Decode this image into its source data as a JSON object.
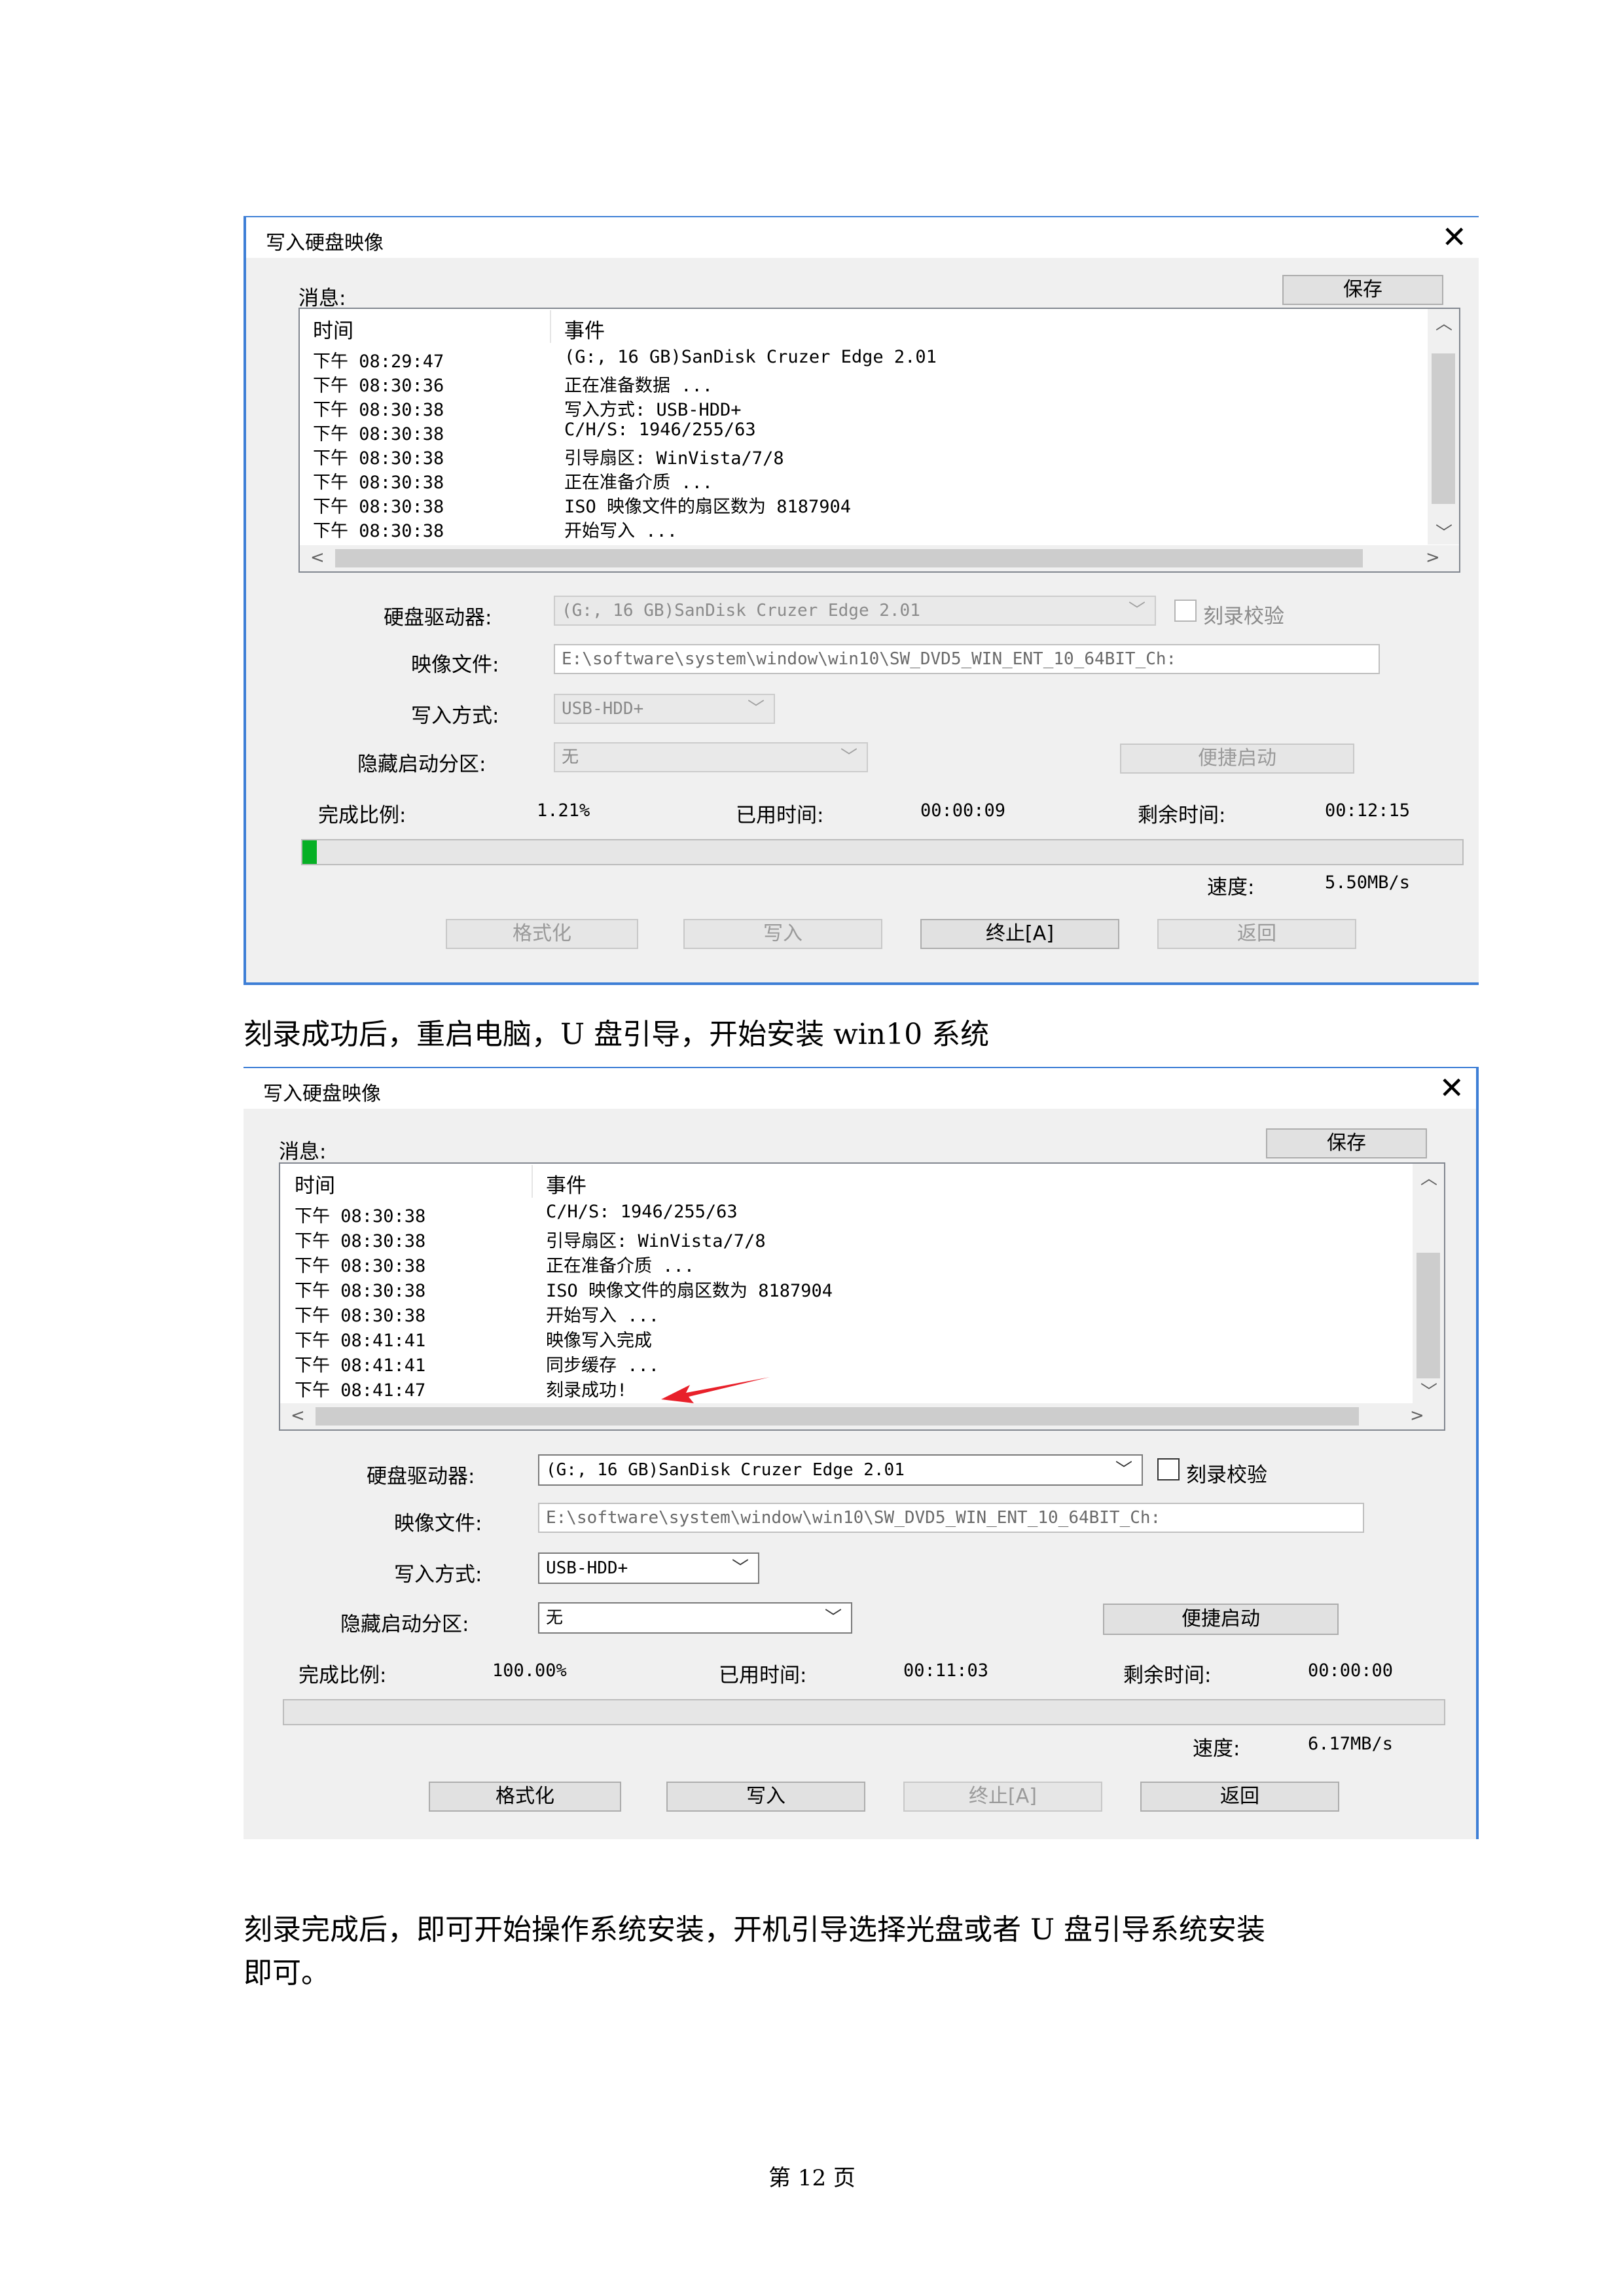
{
  "dialog1": {
    "title": "写入硬盘映像",
    "close_glyph": "✕",
    "messages_label": "消息:",
    "save_label": "保存",
    "col_time": "时间",
    "col_event": "事件",
    "log": [
      {
        "time": "下午 08:29:47",
        "event": "(G:, 16 GB)SanDisk Cruzer Edge      2.01"
      },
      {
        "time": "下午 08:30:36",
        "event": "正在准备数据 ..."
      },
      {
        "time": "下午 08:30:38",
        "event": "写入方式: USB-HDD+"
      },
      {
        "time": "下午 08:30:38",
        "event": "C/H/S: 1946/255/63"
      },
      {
        "time": "下午 08:30:38",
        "event": "引导扇区: WinVista/7/8"
      },
      {
        "time": "下午 08:30:38",
        "event": "正在准备介质 ..."
      },
      {
        "time": "下午 08:30:38",
        "event": "ISO 映像文件的扇区数为 8187904"
      },
      {
        "time": "下午 08:30:38",
        "event": "开始写入 ..."
      }
    ],
    "drive_label": "硬盘驱动器:",
    "drive_value": "(G:, 16 GB)SanDisk Cruzer Edge      2.01",
    "verify_label": "刻录校验",
    "image_label": "映像文件:",
    "image_value": "E:\\software\\system\\window\\win10\\SW_DVD5_WIN_ENT_10_64BIT_Ch:",
    "method_label": "写入方式:",
    "method_value": "USB-HDD+",
    "hidden_label": "隐藏启动分区:",
    "hidden_value": "无",
    "quickboot_label": "便捷启动",
    "percent_label": "完成比例:",
    "percent_value": "1.21%",
    "elapsed_label": "已用时间:",
    "elapsed_value": "00:00:09",
    "remaining_label": "剩余时间:",
    "remaining_value": "00:12:15",
    "progress_fraction": 0.0121,
    "speed_label": "速度:",
    "speed_value": "5.50MB/s",
    "format_label": "格式化",
    "write_label": "写入",
    "abort_label": "终止[A]",
    "return_label": "返回"
  },
  "caption1": "刻录成功后，重启电脑，U 盘引导，开始安装 win10 系统",
  "dialog2": {
    "title": "写入硬盘映像",
    "close_glyph": "✕",
    "messages_label": "消息:",
    "save_label": "保存",
    "col_time": "时间",
    "col_event": "事件",
    "log": [
      {
        "time": "下午 08:30:38",
        "event": "C/H/S: 1946/255/63"
      },
      {
        "time": "下午 08:30:38",
        "event": "引导扇区: WinVista/7/8"
      },
      {
        "time": "下午 08:30:38",
        "event": "正在准备介质 ..."
      },
      {
        "time": "下午 08:30:38",
        "event": "ISO 映像文件的扇区数为 8187904"
      },
      {
        "time": "下午 08:30:38",
        "event": "开始写入 ..."
      },
      {
        "time": "下午 08:41:41",
        "event": "映像写入完成"
      },
      {
        "time": "下午 08:41:41",
        "event": "同步缓存 ..."
      },
      {
        "time": "下午 08:41:47",
        "event": "刻录成功!"
      }
    ],
    "drive_label": "硬盘驱动器:",
    "drive_value": "(G:, 16 GB)SanDisk Cruzer Edge      2.01",
    "verify_label": "刻录校验",
    "image_label": "映像文件:",
    "image_value": "E:\\software\\system\\window\\win10\\SW_DVD5_WIN_ENT_10_64BIT_Ch:",
    "method_label": "写入方式:",
    "method_value": "USB-HDD+",
    "hidden_label": "隐藏启动分区:",
    "hidden_value": "无",
    "quickboot_label": "便捷启动",
    "percent_label": "完成比例:",
    "percent_value": "100.00%",
    "elapsed_label": "已用时间:",
    "elapsed_value": "00:11:03",
    "remaining_label": "剩余时间:",
    "remaining_value": "00:00:00",
    "speed_label": "速度:",
    "speed_value": "6.17MB/s",
    "format_label": "格式化",
    "write_label": "写入",
    "abort_label": "终止[A]",
    "return_label": "返回"
  },
  "caption2_line1": "刻录完成后，即可开始操作系统安装，开机引导选择光盘或者 U 盘引导系统安装",
  "caption2_line2": "即可。",
  "page_footer": "第 12 页",
  "colors": {
    "accent": "#3e7fd6",
    "progress_fill": "#06b025",
    "annotation_arrow": "#e8202a"
  }
}
